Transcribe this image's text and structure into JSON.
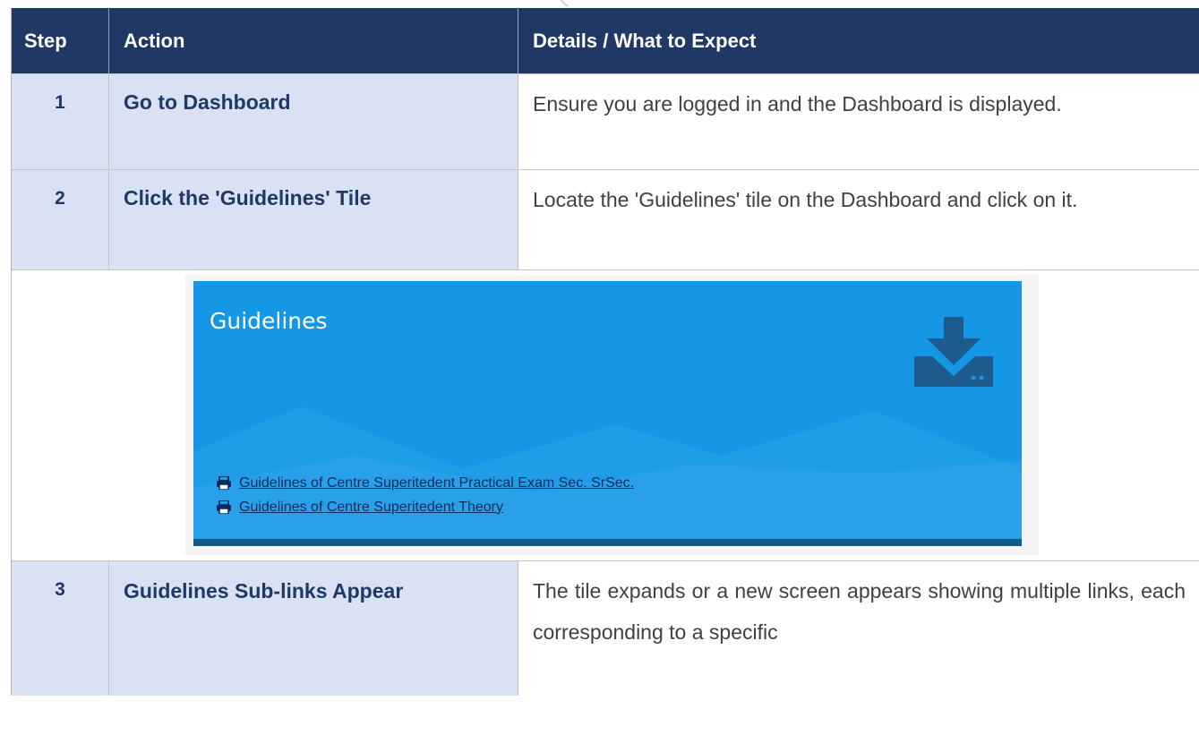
{
  "table": {
    "headers": {
      "step": "Step",
      "action": "Action",
      "details": "Details / What to Expect"
    },
    "rows": [
      {
        "step": "1",
        "action": "Go to Dashboard",
        "details": "Ensure you are logged in and the Dashboard is displayed."
      },
      {
        "step": "2",
        "action": "Click the 'Guidelines' Tile",
        "details": "Locate the 'Guidelines' tile on the Dashboard and click on it."
      },
      {
        "step": "3",
        "action": "Guidelines Sub-links Appear",
        "details": "The tile expands or a new screen appears showing multiple links, each corresponding to a specific"
      }
    ]
  },
  "tile": {
    "title": "Guidelines",
    "icon": "download-icon",
    "links": [
      {
        "icon": "printer-icon",
        "label": "Guidelines of Centre Superitedent Practical Exam Sec. SrSec."
      },
      {
        "icon": "printer-icon",
        "label": "Guidelines of Centre Superitedent Theory"
      }
    ]
  },
  "colors": {
    "header_bg": "#1f3864",
    "row_bg": "#d9e2f3",
    "tile_bg": "#1597e5",
    "action_text": "#1f3864"
  }
}
